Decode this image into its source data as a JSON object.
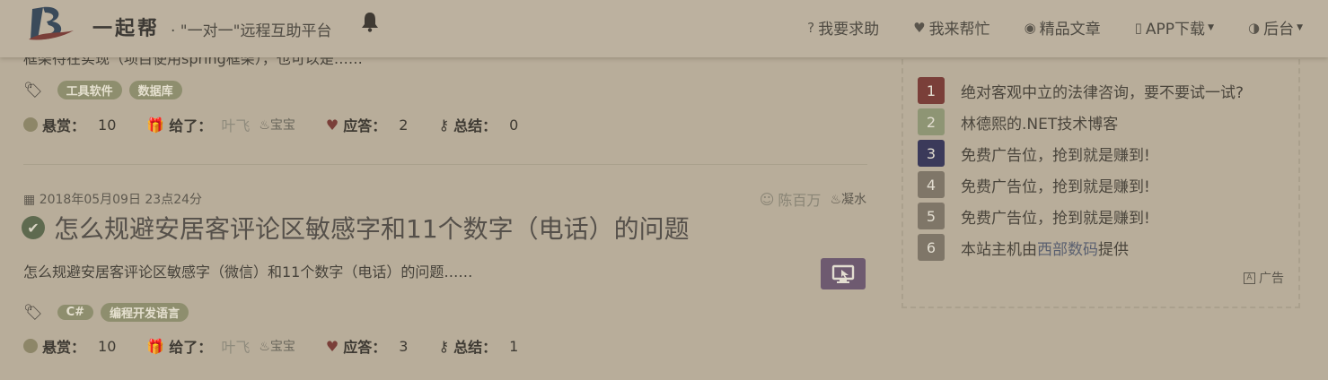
{
  "header": {
    "brand": "一起帮",
    "slogan": "· \"一对一\"远程互助平台",
    "nav": [
      {
        "icon": "question-circle-icon",
        "glyph": "?",
        "label": "我要求助"
      },
      {
        "icon": "heart-icon",
        "glyph": "♥",
        "label": "我来帮忙"
      },
      {
        "icon": "eye-icon",
        "glyph": "◉",
        "label": "精品文章"
      },
      {
        "icon": "mobile-icon",
        "glyph": "▯",
        "label": "APP下载",
        "dropdown": true
      },
      {
        "icon": "dashboard-icon",
        "glyph": "◑",
        "label": "后台",
        "dropdown": true
      }
    ]
  },
  "posts": [
    {
      "excerpt_cut": "框架待在实现（项目使用spring框架），也可以是……",
      "tags": [
        "工具软件",
        "数据库"
      ],
      "bounty_label": "悬赏：",
      "bounty": "10",
      "given_label": "给了：",
      "given_user": "叶飞",
      "given_level": "宝宝",
      "answers_label": "应答：",
      "answers": "2",
      "summary_label": "总结：",
      "summary": "0"
    },
    {
      "date": "2018年05月09日 23点24分",
      "author": "陈百万",
      "author_level": "凝水",
      "title": "怎么规避安居客评论区敏感字和11个数字（电话）的问题",
      "excerpt": "怎么规避安居客评论区敏感字（微信）和11个数字（电话）的问题……",
      "tags": [
        "C#",
        "编程开发语言"
      ],
      "bounty_label": "悬赏：",
      "bounty": "10",
      "given_label": "给了：",
      "given_user": "叶飞",
      "given_level": "宝宝",
      "answers_label": "应答：",
      "answers": "3",
      "summary_label": "总结：",
      "summary": "1"
    }
  ],
  "sidebar": {
    "ads": [
      {
        "num": "1",
        "text": "绝对客观中立的法律咨询，要不要试一试?",
        "color": "#7a3f39"
      },
      {
        "num": "2",
        "text": "林德熙的.NET技术博客",
        "color": "#8e9574"
      },
      {
        "num": "3",
        "text": "免费广告位，抢到就是赚到!",
        "color": "#3b3a5a"
      },
      {
        "num": "4",
        "text": "免费广告位，抢到就是赚到!",
        "color": "#7f7668"
      },
      {
        "num": "5",
        "text": "免费广告位，抢到就是赚到!",
        "color": "#7f7668"
      },
      {
        "num": "6",
        "text_before": "本站主机由",
        "link": "西部数码",
        "text_after": "提供",
        "color": "#7f7668"
      }
    ],
    "ad_label": "广告"
  },
  "colors": {
    "background": "#b8ad9a",
    "tag": "#8e8e6e",
    "remote_button": "#6e5a70"
  }
}
